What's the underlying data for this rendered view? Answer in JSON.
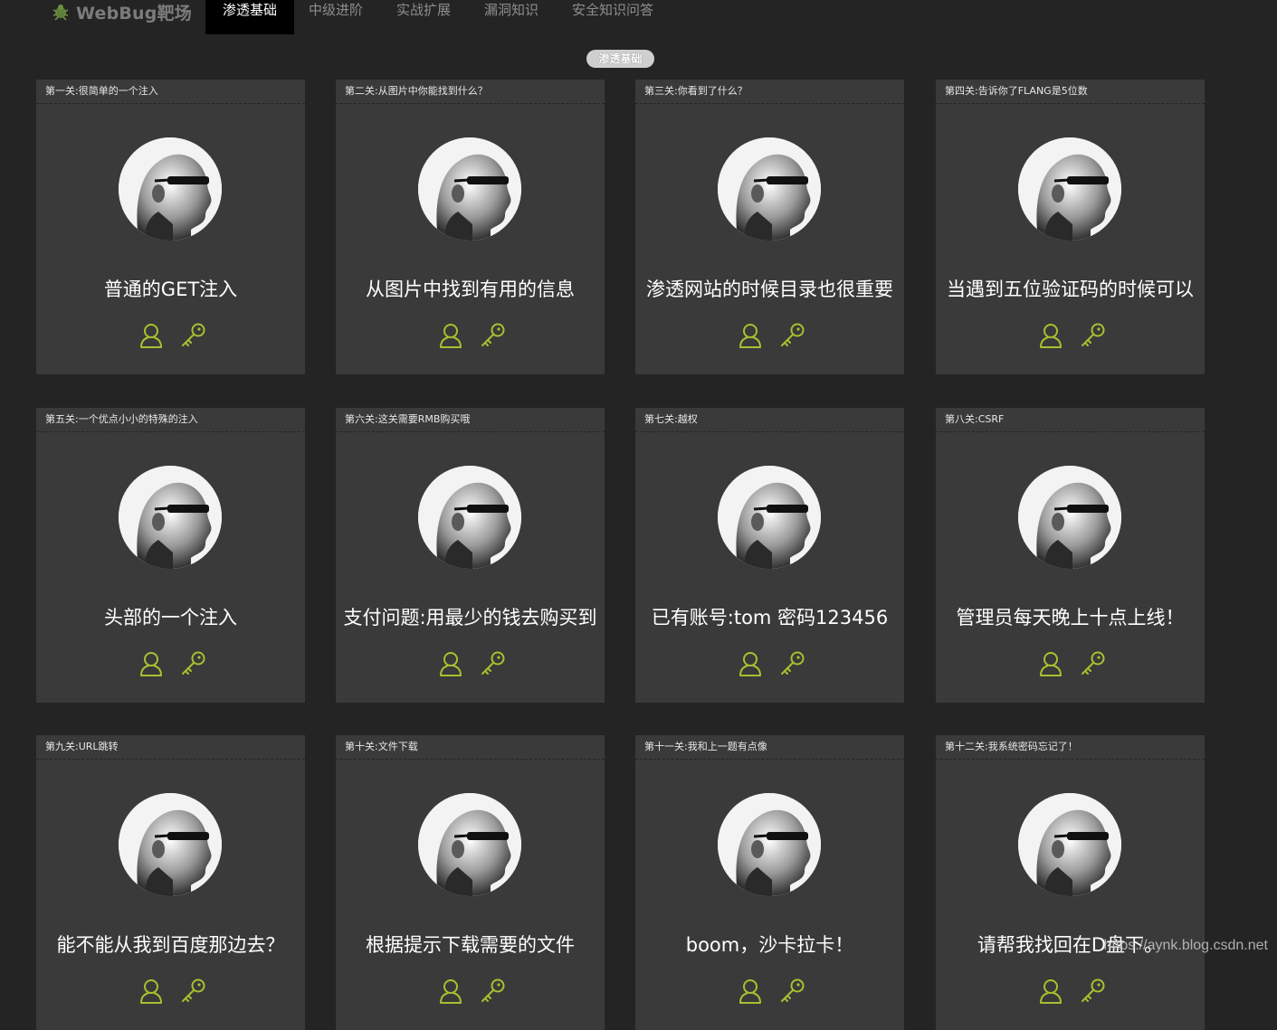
{
  "brand": {
    "name": "WebBug靶场",
    "logo_icon": "bug-icon"
  },
  "nav": {
    "items": [
      {
        "label": "渗透基础",
        "active": true
      },
      {
        "label": "中级进阶",
        "active": false
      },
      {
        "label": "实战扩展",
        "active": false
      },
      {
        "label": "漏洞知识",
        "active": false
      },
      {
        "label": "安全知识问答",
        "active": false
      }
    ]
  },
  "section": {
    "badge": "渗透基础"
  },
  "colors": {
    "accent": "#a7c12f",
    "card_bg": "#3a3a3a",
    "page_bg": "#242424"
  },
  "cards": [
    {
      "heading": "第一关:很简单的一个注入",
      "title": "普通的GET注入"
    },
    {
      "heading": "第二关:从图片中你能找到什么？",
      "title": "从图片中找到有用的信息"
    },
    {
      "heading": "第三关:你看到了什么？",
      "title": "渗透网站的时候目录也很重要"
    },
    {
      "heading": "第四关:告诉你了FLANG是5位数",
      "title": "当遇到五位验证码的时候可以"
    },
    {
      "heading": "第五关:一个优点小小的特殊的注入",
      "title": "头部的一个注入"
    },
    {
      "heading": "第六关:这关需要RMB购买哦",
      "title": "支付问题:用最少的钱去购买到"
    },
    {
      "heading": "第七关:越权",
      "title": "已有账号:tom 密码123456"
    },
    {
      "heading": "第八关:CSRF",
      "title": "管理员每天晚上十点上线！"
    },
    {
      "heading": "第九关:URL跳转",
      "title": "能不能从我到百度那边去？"
    },
    {
      "heading": "第十关:文件下载",
      "title": "根据提示下载需要的文件"
    },
    {
      "heading": "第十一关:我和上一题有点像",
      "title": "boom，沙卡拉卡！"
    },
    {
      "heading": "第十二关:我系统密码忘记了！",
      "title": "请帮我找回在D盘下。"
    }
  ],
  "card_icons": {
    "user": "user-icon",
    "key": "key-icon"
  },
  "watermark": "https://aynk.blog.csdn.net"
}
